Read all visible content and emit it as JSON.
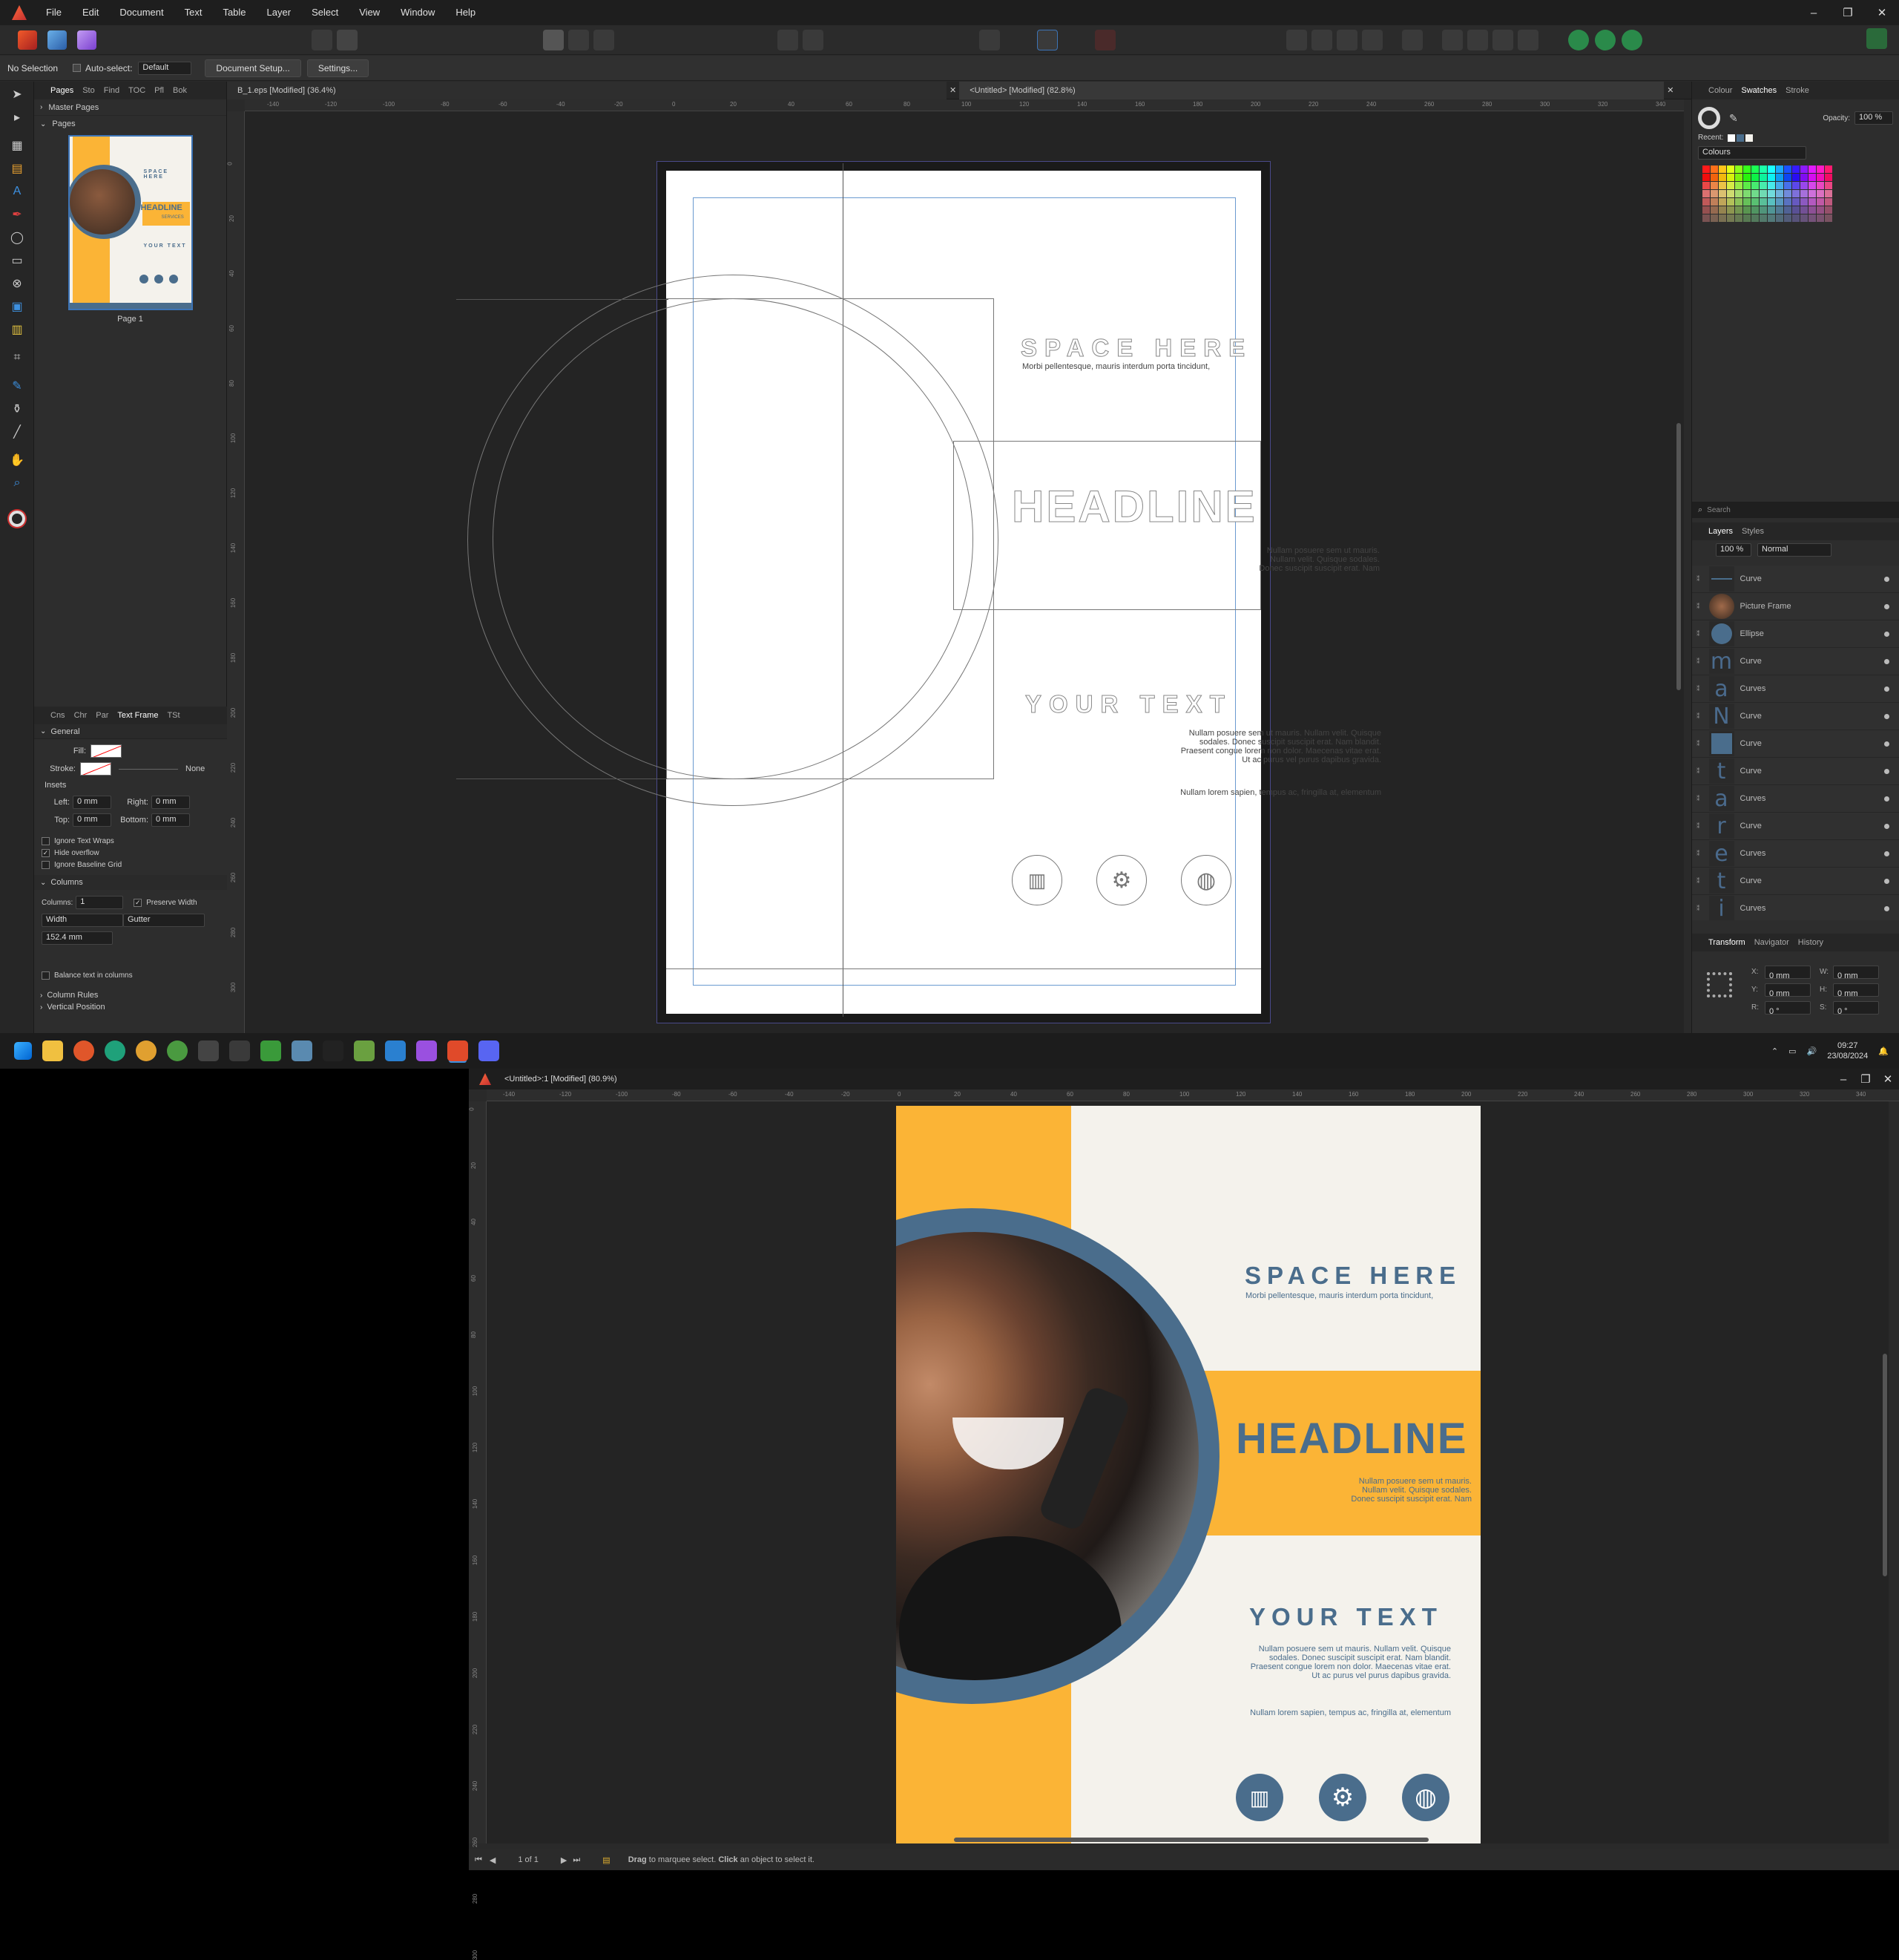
{
  "menu": [
    "File",
    "Edit",
    "Document",
    "Text",
    "Table",
    "Layer",
    "Select",
    "View",
    "Window",
    "Help"
  ],
  "context": {
    "selection": "No Selection",
    "autoselect": "Auto-select:",
    "autoselect_value": "Default",
    "doc_setup": "Document Setup...",
    "settings": "Settings..."
  },
  "left_panel": {
    "tabs": [
      "Pages",
      "Sto",
      "Find",
      "TOC",
      "Pfl",
      "Bok"
    ],
    "master_pages": "Master Pages",
    "pages": "Pages",
    "page_label": "Page 1"
  },
  "text_frame_panel": {
    "tabs": [
      "Cns",
      "Chr",
      "Par",
      "Text Frame",
      "TSt"
    ],
    "general": "General",
    "fill": "Fill:",
    "stroke": "Stroke:",
    "stroke_value": "None",
    "insets": "Insets",
    "left": "Left:",
    "right": "Right:",
    "top": "Top:",
    "bottom": "Bottom:",
    "inset_value": "0 mm",
    "ignore_wraps": "Ignore Text Wraps",
    "hide_overflow": "Hide overflow",
    "ignore_baseline": "Ignore Baseline Grid",
    "columns_head": "Columns",
    "columns": "Columns:",
    "columns_value": "1",
    "preserve_width": "Preserve Width",
    "width": "Width",
    "gutter": "Gutter",
    "width_value": "152.4 mm",
    "balance": "Balance text in columns",
    "column_rules": "Column Rules",
    "vertical_position": "Vertical Position"
  },
  "doc_tabs": [
    {
      "label": "B_1.eps [Modified] (36.4%)"
    },
    {
      "label": "<Untitled> [Modified] (82.8%)"
    }
  ],
  "ruler_ticks": [
    "-140",
    "-120",
    "-100",
    "-80",
    "-60",
    "-40",
    "-20",
    "0",
    "20",
    "40",
    "60",
    "80",
    "100",
    "120",
    "140",
    "160",
    "180",
    "200",
    "220",
    "240",
    "260",
    "280",
    "300",
    "320",
    "340"
  ],
  "ruler_vticks": [
    "0",
    "20",
    "40",
    "60",
    "80",
    "100",
    "120",
    "140",
    "160",
    "180",
    "200",
    "220",
    "240",
    "260",
    "280",
    "300"
  ],
  "right_panel": {
    "tabs": [
      "Colour",
      "Swatches",
      "Stroke"
    ],
    "opacity_label": "Opacity:",
    "opacity_value": "100 %",
    "recent": "Recent:",
    "palette": "Colours",
    "search": "Search",
    "layers_tabs": [
      "Layers",
      "Styles"
    ],
    "layers_opacity": "100 %",
    "blend": "Normal",
    "transform_tabs": [
      "Transform",
      "Navigator",
      "History"
    ],
    "x": "X:",
    "y": "Y:",
    "w": "W:",
    "h": "H:",
    "r": "R:",
    "s": "S:",
    "zero_mm": "0 mm",
    "zero_deg": "0 °"
  },
  "layers": [
    {
      "name": "Curve",
      "thumb": "—"
    },
    {
      "name": "Picture Frame",
      "thumb": "photo"
    },
    {
      "name": "Ellipse",
      "thumb": "●"
    },
    {
      "name": "Curve",
      "thumb": "m"
    },
    {
      "name": "Curves",
      "thumb": "a"
    },
    {
      "name": "Curve",
      "thumb": "N"
    },
    {
      "name": "Curve",
      "thumb": "■"
    },
    {
      "name": "Curve",
      "thumb": "t"
    },
    {
      "name": "Curves",
      "thumb": "a"
    },
    {
      "name": "Curve",
      "thumb": "r"
    },
    {
      "name": "Curves",
      "thumb": "e"
    },
    {
      "name": "Curve",
      "thumb": "t"
    },
    {
      "name": "Curves",
      "thumb": "i"
    }
  ],
  "poster": {
    "space_here": "SPACE HERE",
    "space_sub": "Morbi pellentesque, mauris interdum porta tincidunt,",
    "headline": "HEADLINE",
    "headline_sub1": "Nullam posuere sem ut mauris.",
    "headline_sub2": "Nullam velit. Quisque sodales.",
    "headline_sub3": "Donec suscipit suscipit erat. Nam",
    "your_text": "YOUR TEXT",
    "body1": "Nullam posuere sem ut mauris. Nullam velit. Quisque",
    "body2": "sodales. Donec suscipit suscipit erat. Nam blandit.",
    "body3": "Praesent congue lorem non dolor. Maecenas vitae erat.",
    "body4": "Ut ac purus vel purus dapibus gravida.",
    "footer": "Nullam lorem sapien, tempus ac, fringilla at, elementum",
    "thumb_services": "SERVICES"
  },
  "taskbar": {
    "time": "09:27",
    "date": "23/08/2024"
  },
  "win2": {
    "title": "<Untitled>:1 [Modified] (80.9%)",
    "page_count": "1 of 1",
    "status_drag": "Drag",
    "status_mid": " to marquee select. ",
    "status_click": "Click",
    "status_end": " an object to select it."
  },
  "colors": {
    "orange": "#fbb436",
    "slate": "#4a6d8c",
    "cream": "#f4f2ec",
    "accent": "#3d74b6"
  }
}
